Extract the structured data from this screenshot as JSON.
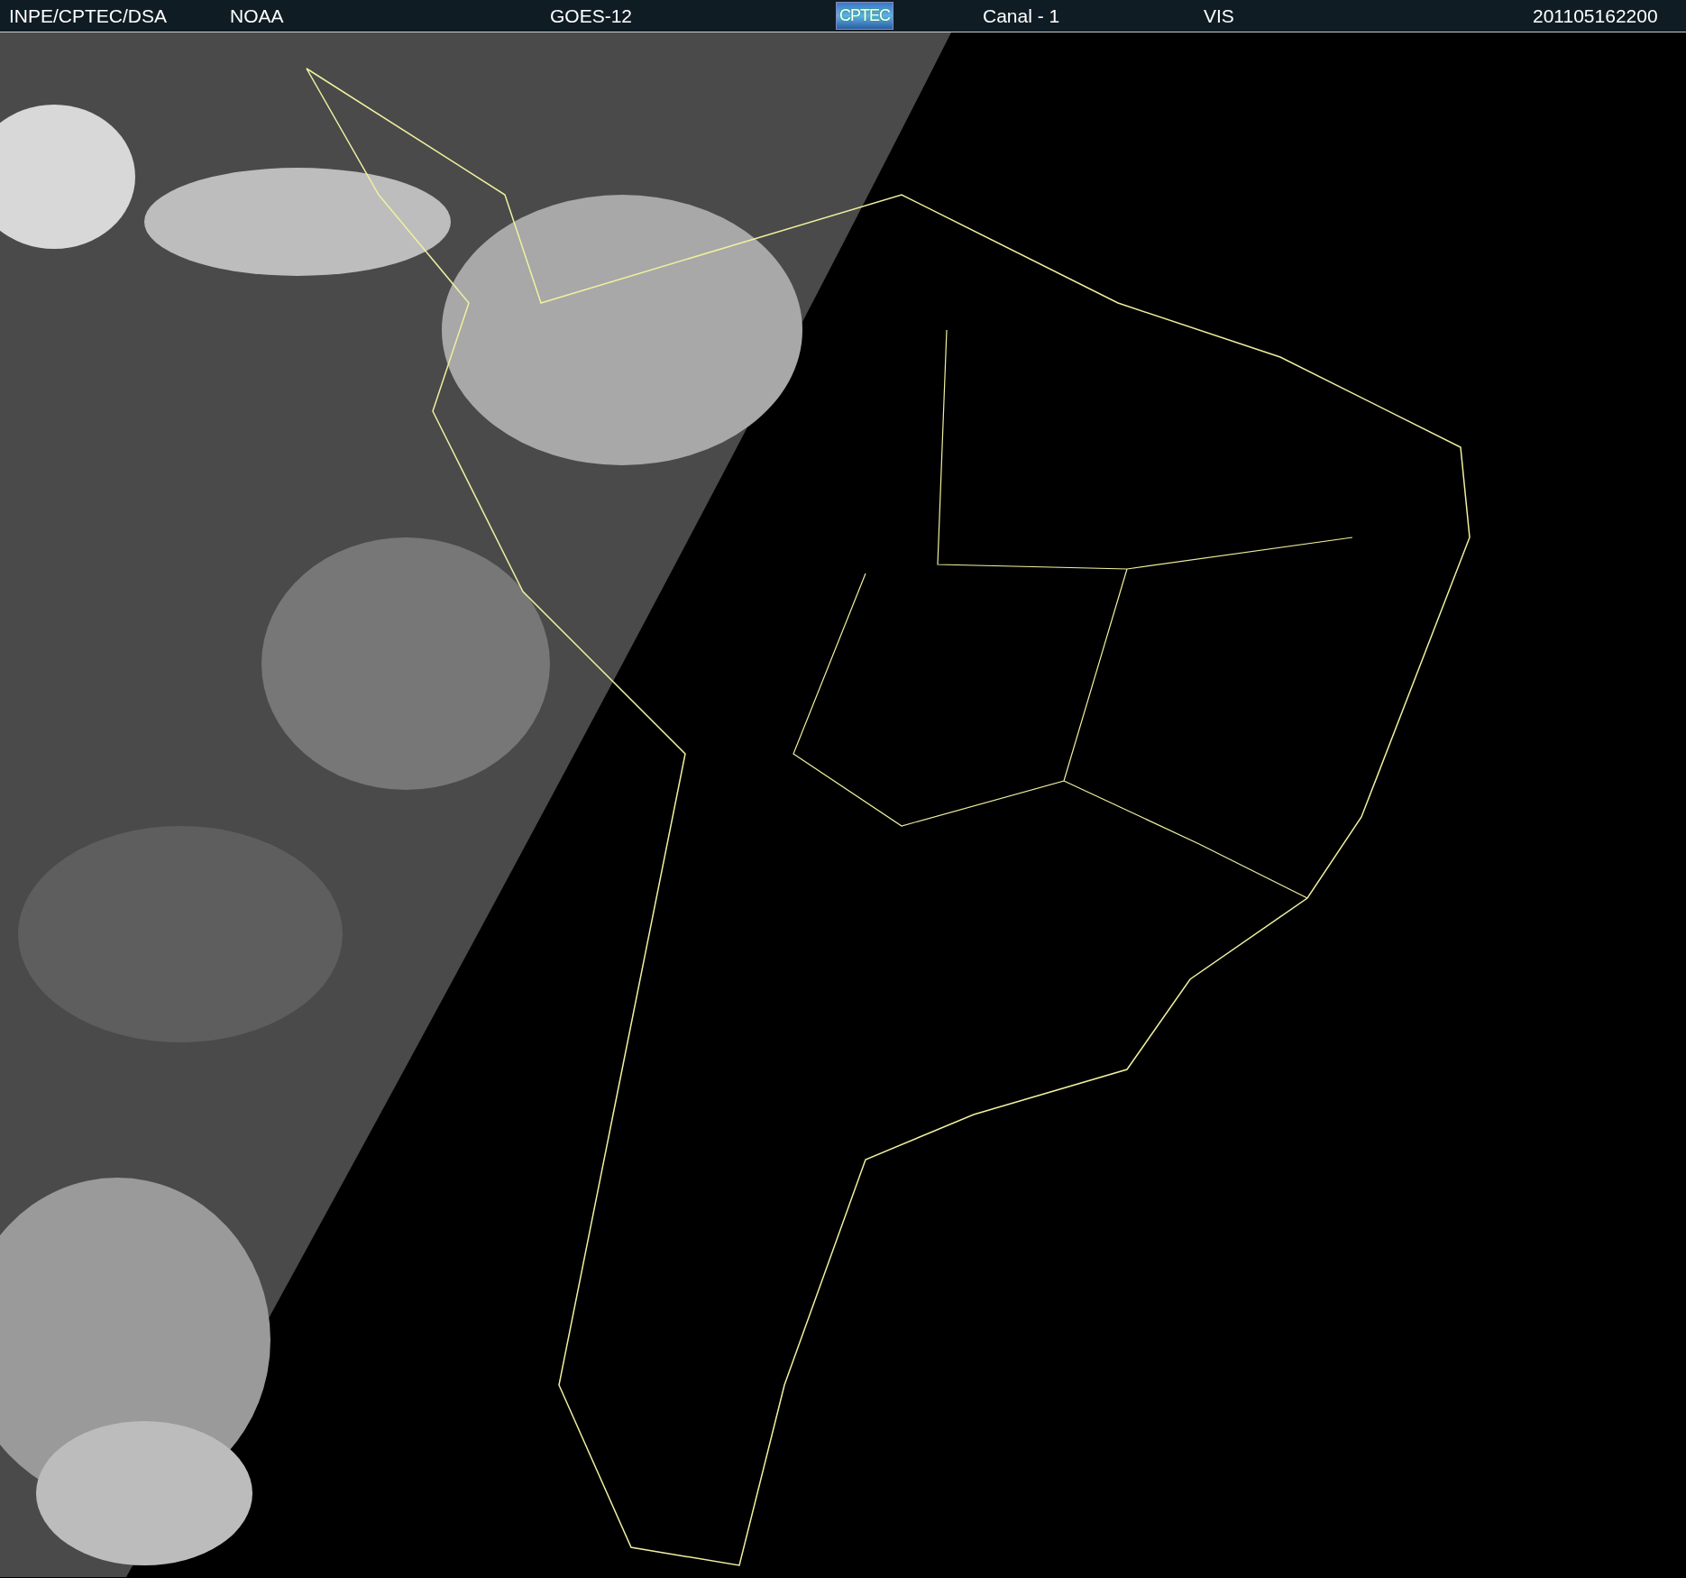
{
  "header": {
    "items": [
      {
        "kind": "text",
        "text": "INPE/CPTEC/DSA"
      },
      {
        "kind": "text",
        "text": "NOAA"
      },
      {
        "kind": "text",
        "text": "GOES-12"
      },
      {
        "kind": "logo",
        "text": "CPTEC"
      },
      {
        "kind": "text",
        "text": "Canal - 1"
      },
      {
        "kind": "text",
        "text": "VIS"
      },
      {
        "kind": "text",
        "text": "201105162200"
      }
    ]
  }
}
